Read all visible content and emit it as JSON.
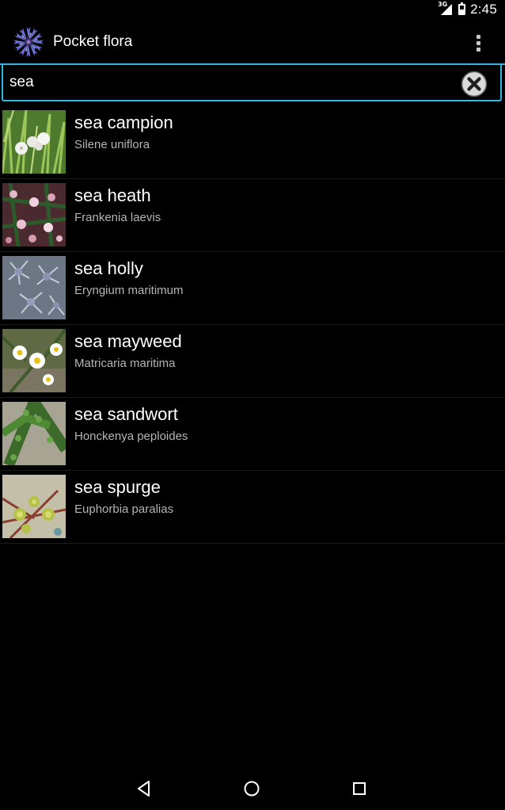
{
  "status_bar": {
    "network": "3G",
    "time": "2:45"
  },
  "action_bar": {
    "title": "Pocket flora",
    "app_icon": "cornflower-icon",
    "overflow_icon": "more-vert-icon"
  },
  "search": {
    "value": "sea",
    "clear_icon": "clear-icon",
    "accent_color": "#33b5e5"
  },
  "plants": [
    {
      "common": "sea campion",
      "latin": "Silene uniflora"
    },
    {
      "common": "sea heath",
      "latin": "Frankenia laevis"
    },
    {
      "common": "sea holly",
      "latin": "Eryngium maritimum"
    },
    {
      "common": "sea mayweed",
      "latin": "Matricaria maritima"
    },
    {
      "common": "sea sandwort",
      "latin": "Honckenya peploides"
    },
    {
      "common": "sea spurge",
      "latin": "Euphorbia paralias"
    }
  ],
  "nav_bar": {
    "back_icon": "back-icon",
    "home_icon": "home-icon",
    "recents_icon": "recents-icon"
  }
}
